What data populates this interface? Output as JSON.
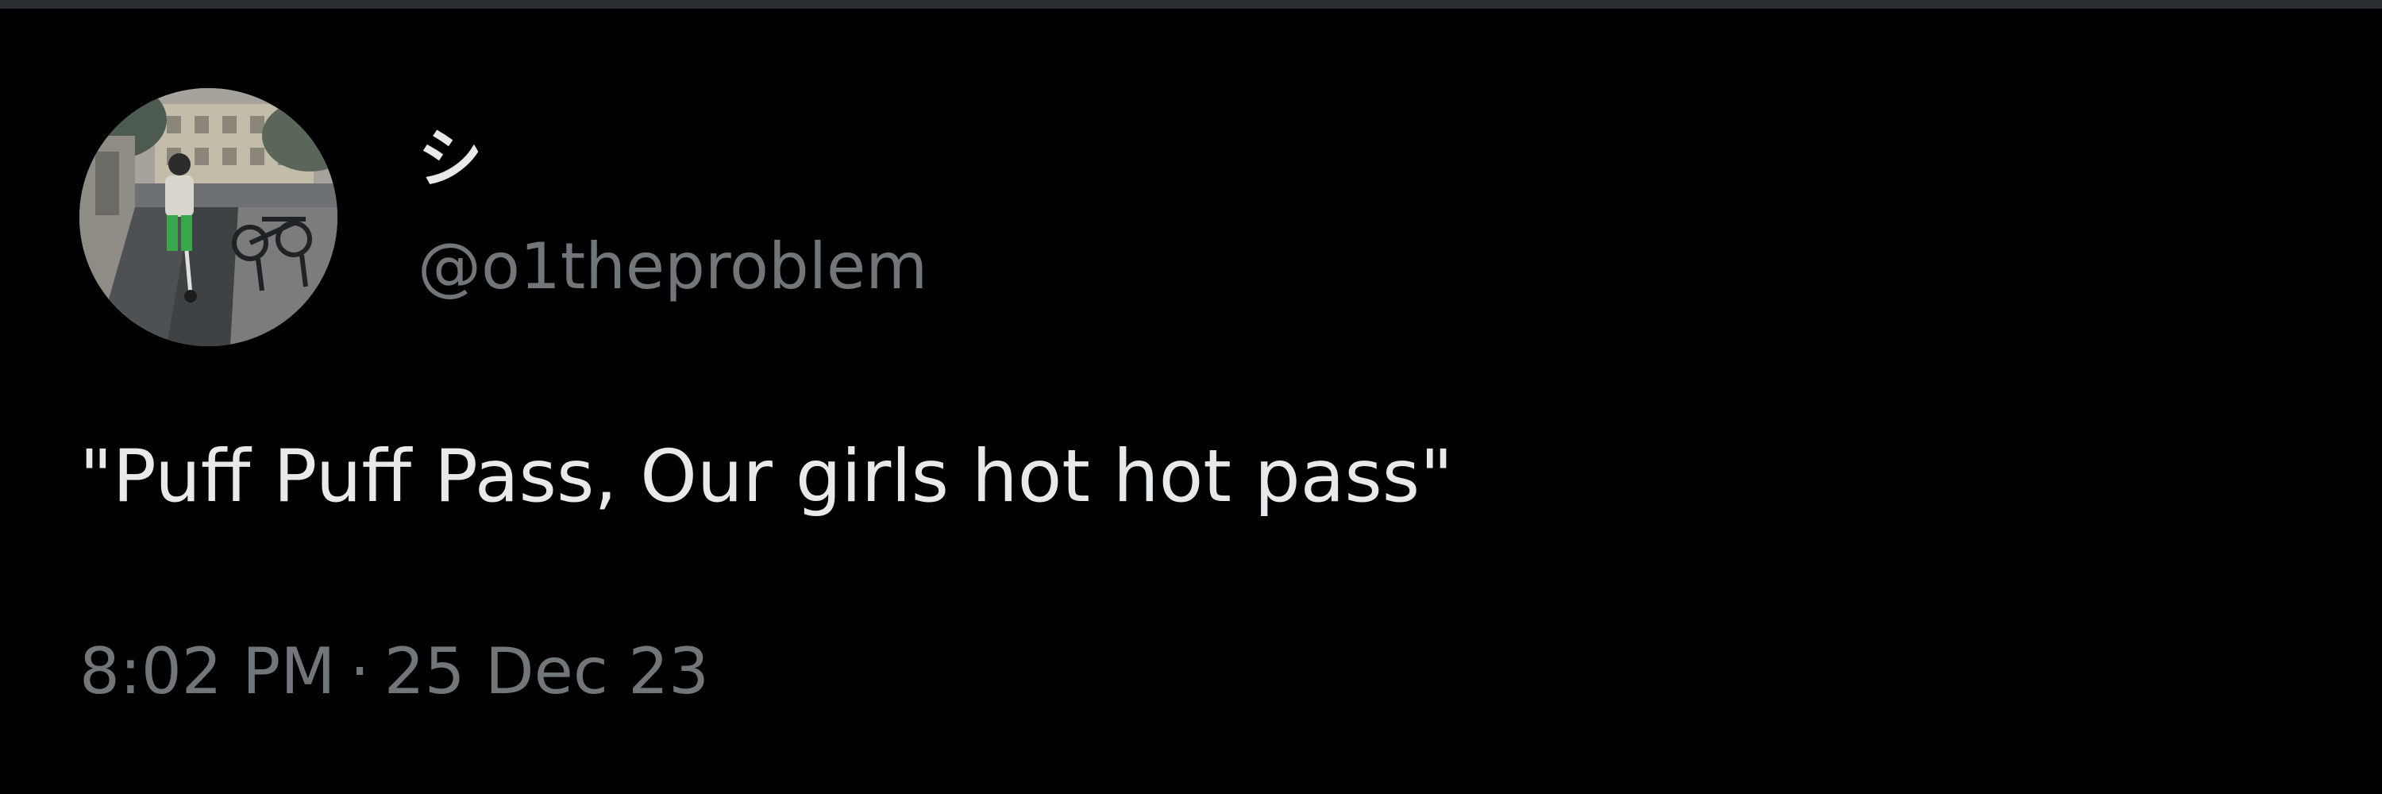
{
  "tweet": {
    "author": {
      "display_name": "シ",
      "handle": "@o1theproblem",
      "avatar": "profile-photo"
    },
    "text": "\"Puff Puff Pass, Our girls hot hot pass\"",
    "time": "8:02 PM",
    "separator": "·",
    "date": "25 Dec 23"
  },
  "colors": {
    "background": "#000000",
    "primary_text": "#e7e9ea",
    "secondary_text": "#71767b"
  }
}
